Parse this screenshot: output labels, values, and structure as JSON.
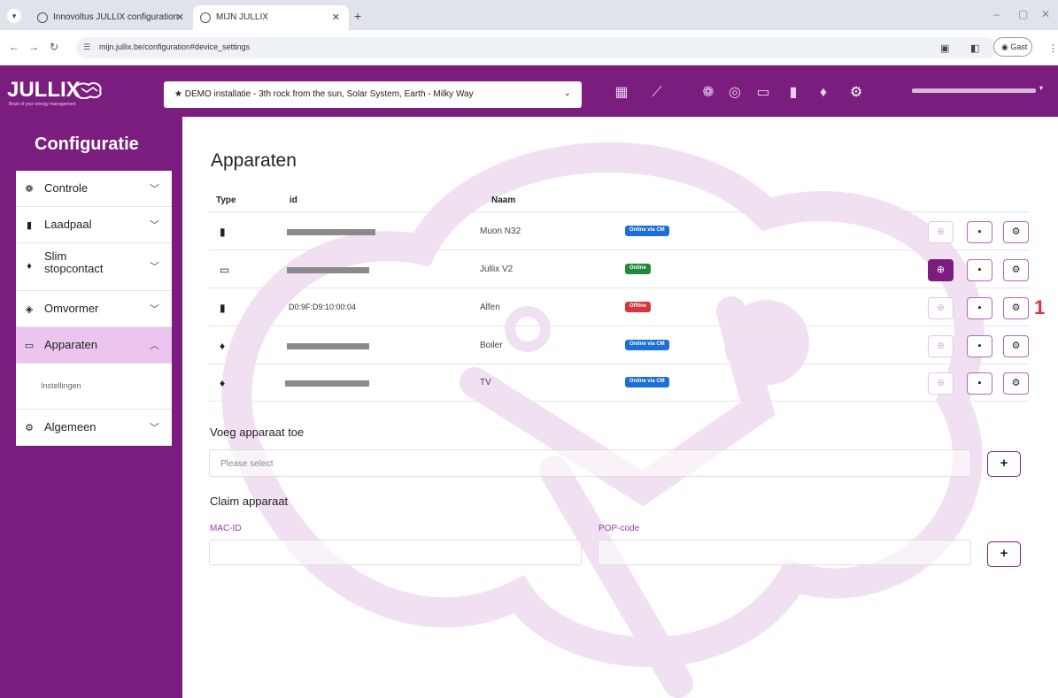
{
  "browser": {
    "tabs": [
      {
        "label": "Innovoltus JULLIX configuration",
        "active": false
      },
      {
        "label": "MIJN JULLIX",
        "active": true
      }
    ],
    "url": "mijn.jullix.be/configuration#device_settings",
    "profile_label": "Gast"
  },
  "header": {
    "logo_text": "JULLIX",
    "logo_tagline": "Brain of your energy management",
    "installation": "★  DEMO installatie - 3th rock from the sun, Solar System, Earth - Milky Way",
    "icons": [
      "dashboard-icon",
      "chart-icon",
      "brain-icon",
      "meter-icon",
      "charger-icon",
      "plug-icon",
      "gear-icon"
    ]
  },
  "sidebar": {
    "title": "Configuratie",
    "items": [
      {
        "label": "Controle",
        "icon": "brain-icon",
        "expanded": false
      },
      {
        "label": "Laadpaal",
        "icon": "charger-icon",
        "expanded": false
      },
      {
        "label": "Slim stopcontact",
        "icon": "plug-icon",
        "expanded": false
      },
      {
        "label": "Omvormer",
        "icon": "solar-icon",
        "expanded": false
      },
      {
        "label": "Apparaten",
        "icon": "device-icon",
        "expanded": true,
        "active": true
      },
      {
        "label": "Algemeen",
        "icon": "gear-icon",
        "expanded": false
      }
    ],
    "subitems": {
      "apparaten": [
        "Instellingen"
      ]
    }
  },
  "main": {
    "title": "Apparaten",
    "table": {
      "columns": [
        "Type",
        "id",
        "Naam"
      ],
      "rows": [
        {
          "type": "charger-icon",
          "id": "",
          "name": "Muon N32",
          "status": "Online via CM",
          "status_color": "#1c6fd8"
        },
        {
          "type": "device-icon",
          "id": "",
          "name": "Jullix V2",
          "status": "Online",
          "status_color": "#1f8a3a"
        },
        {
          "type": "charger-icon",
          "id": "D0:9F:D9:10:00:04",
          "name": "Alfen",
          "status": "Offline",
          "status_color": "#d8343f"
        },
        {
          "type": "plug-icon",
          "id": "",
          "name": "Boiler",
          "status": "Online via CM",
          "status_color": "#1c6fd8"
        },
        {
          "type": "plug-icon",
          "id": "",
          "name": "TV",
          "status": "Online via CM",
          "status_color": "#1c6fd8"
        }
      ]
    },
    "annotation": "1",
    "add_device": {
      "title": "Voeg apparaat toe",
      "placeholder": "Please select",
      "button": "+"
    },
    "claim_device": {
      "title": "Claim apparaat",
      "mac_label": "MAC-ID",
      "pop_label": "POP-code",
      "button": "+"
    }
  },
  "colors": {
    "brand": "#7b1d7e",
    "active_menu": "#ecc5ee",
    "online": "#1f8a3a",
    "online_cm": "#1c6fd8",
    "offline": "#d8343f"
  }
}
